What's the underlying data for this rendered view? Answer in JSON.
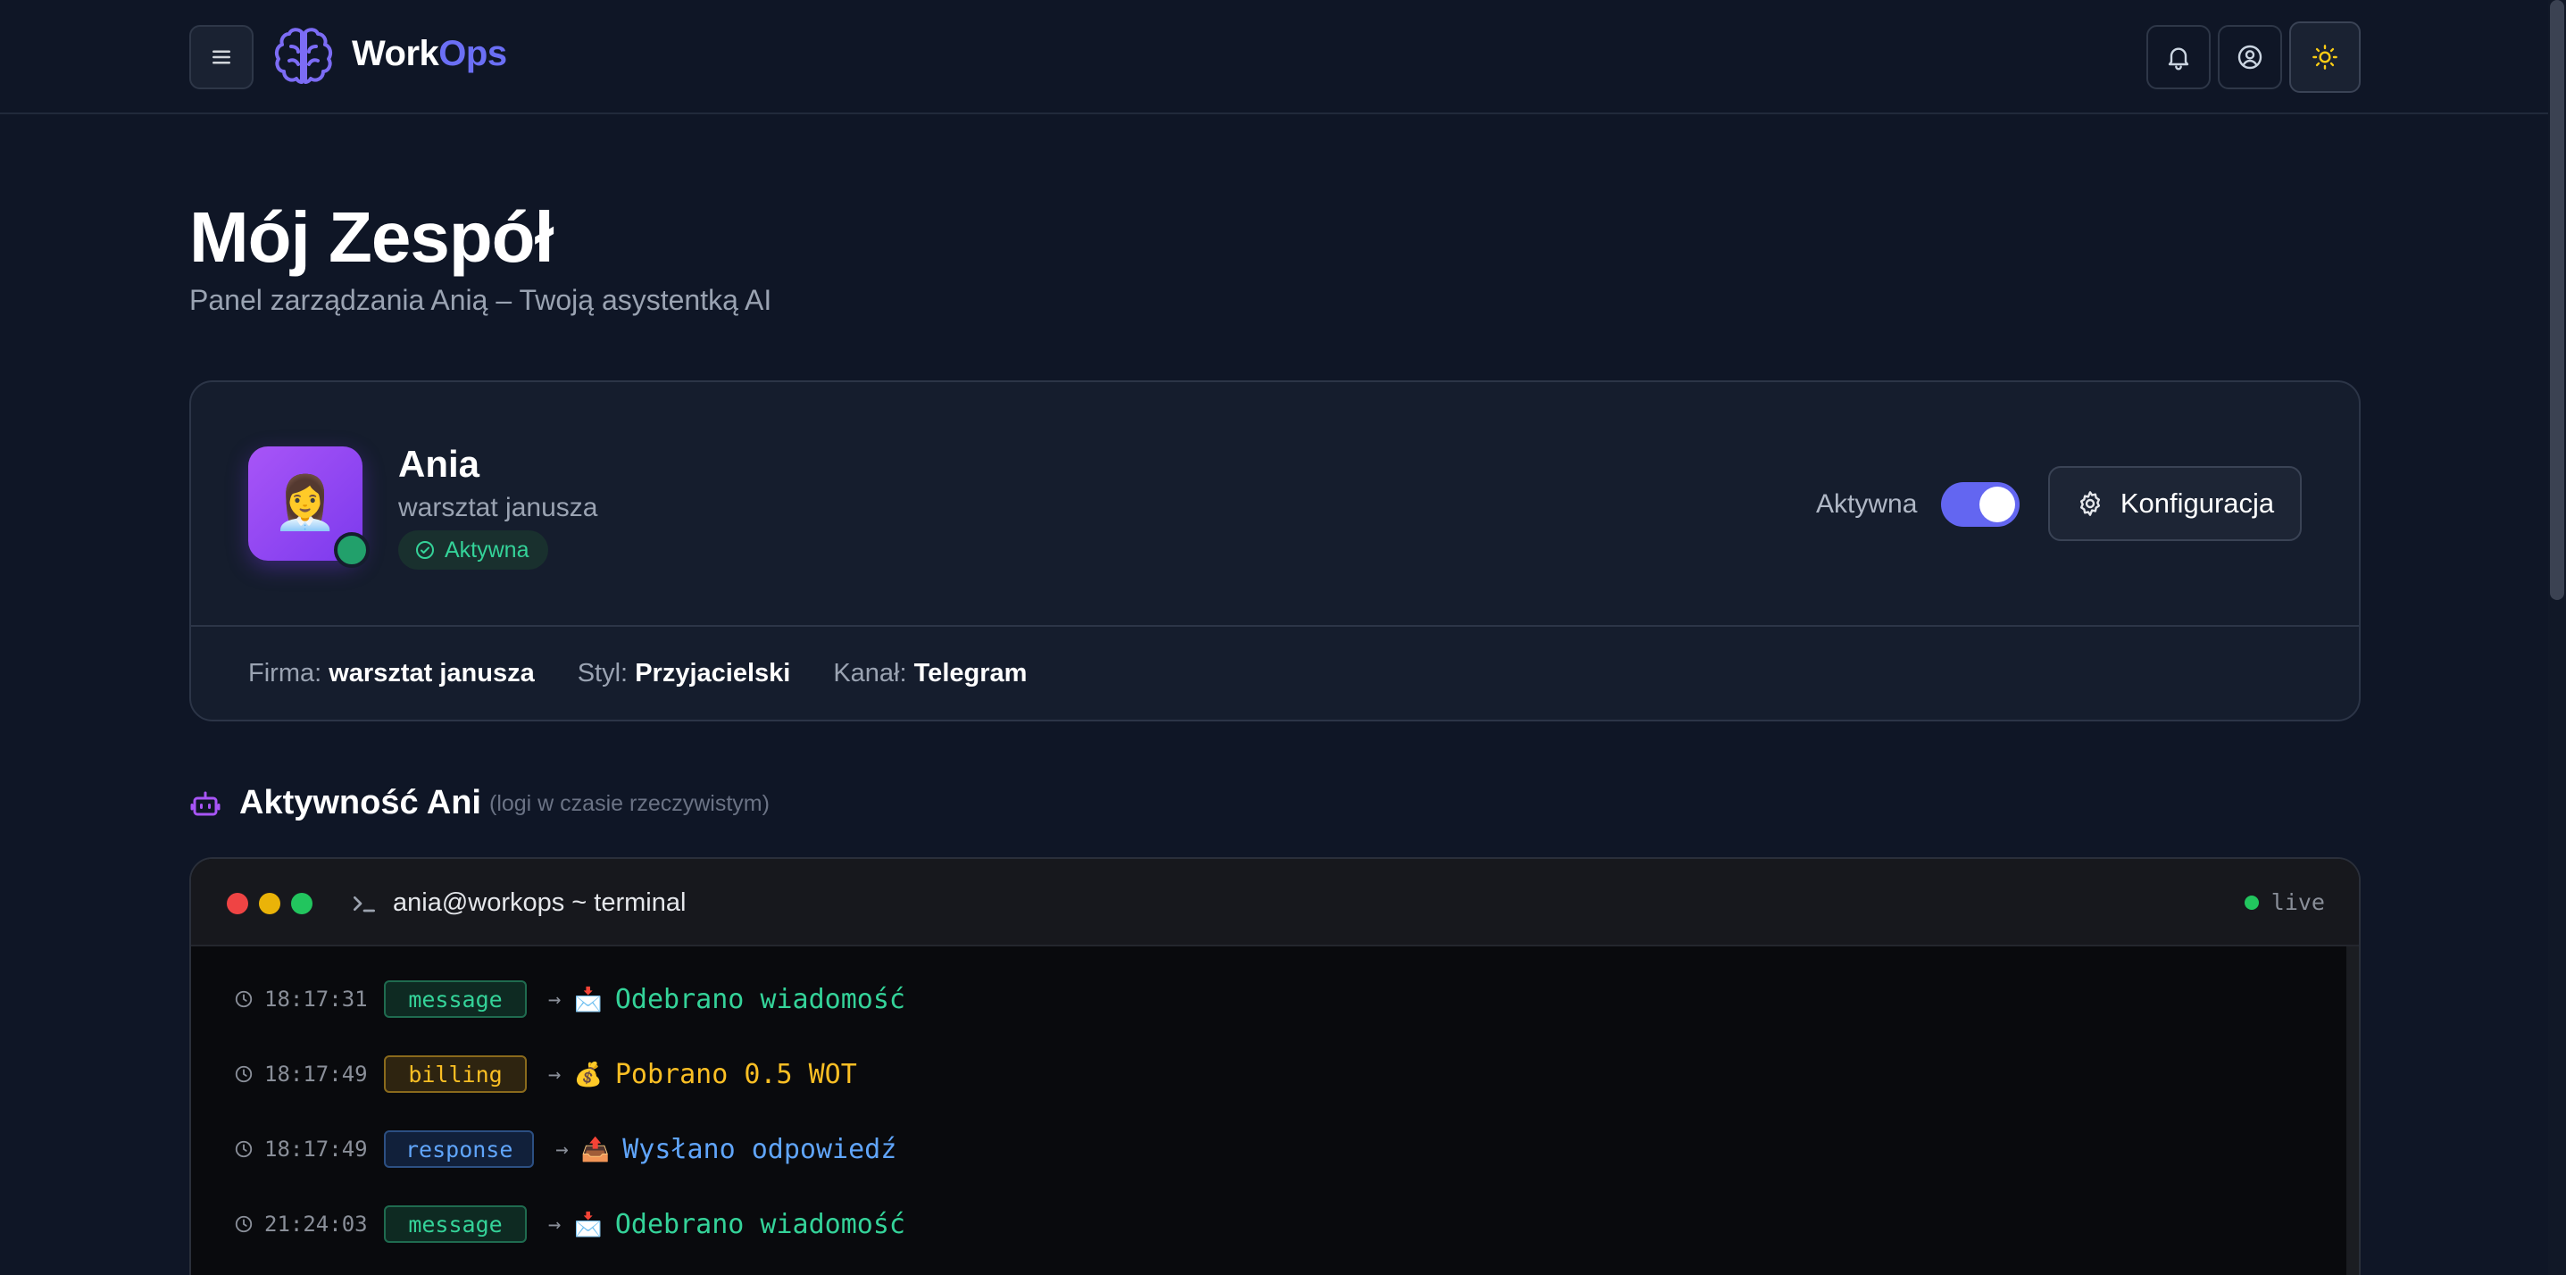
{
  "brand": {
    "name_part1": "Work",
    "name_part2": "Ops"
  },
  "header": {
    "title": "Mój Zespół",
    "subtitle": "Panel zarządzania Anią – Twoją asystentką AI"
  },
  "agent": {
    "avatar_emoji": "👩‍💼",
    "name": "Ania",
    "company": "warsztat janusza",
    "status": "Aktywna",
    "toggle_label": "Aktywna",
    "toggle_on": true,
    "config_label": "Konfiguracja",
    "meta": [
      {
        "key": "Firma:",
        "value": "warsztat janusza"
      },
      {
        "key": "Styl:",
        "value": "Przyjacielski"
      },
      {
        "key": "Kanał:",
        "value": "Telegram"
      }
    ]
  },
  "activity": {
    "title": "Aktywność Ani",
    "note": "(logi w czasie rzeczywistym)"
  },
  "terminal": {
    "title": "ania@workops ~ terminal",
    "live_label": "live",
    "logs": [
      {
        "time": "18:17:31",
        "tag": "message",
        "arrow": "→",
        "emoji": "📩",
        "text": "Odebrano wiadomość",
        "color": "#34d399",
        "tag_bg": "#0e2a22",
        "tag_border": "#1f6b4f"
      },
      {
        "time": "18:17:49",
        "tag": "billing",
        "arrow": "→",
        "emoji": "💰",
        "text": "Pobrano 0.5 WOT",
        "color": "#fbbf24",
        "tag_bg": "#2e2410",
        "tag_border": "#8a6a1c"
      },
      {
        "time": "18:17:49",
        "tag": "response",
        "arrow": "→",
        "emoji": "📤",
        "text": "Wysłano odpowiedź",
        "color": "#60a5fa",
        "tag_bg": "#11203a",
        "tag_border": "#2c4f82"
      },
      {
        "time": "21:24:03",
        "tag": "message",
        "arrow": "→",
        "emoji": "📩",
        "text": "Odebrano wiadomość",
        "color": "#34d399",
        "tag_bg": "#0e2a22",
        "tag_border": "#1f6b4f"
      }
    ]
  },
  "colors": {
    "accent": "#6366f1",
    "success": "#34d399",
    "warning": "#fbbf24",
    "info": "#60a5fa",
    "background": "#0f1626"
  },
  "icons": [
    "menu-icon",
    "brain-icon",
    "bell-icon",
    "user-circle-icon",
    "sun-icon",
    "check-circle-icon",
    "gear-icon",
    "robot-icon",
    "terminal-prompt-icon",
    "clock-icon"
  ]
}
